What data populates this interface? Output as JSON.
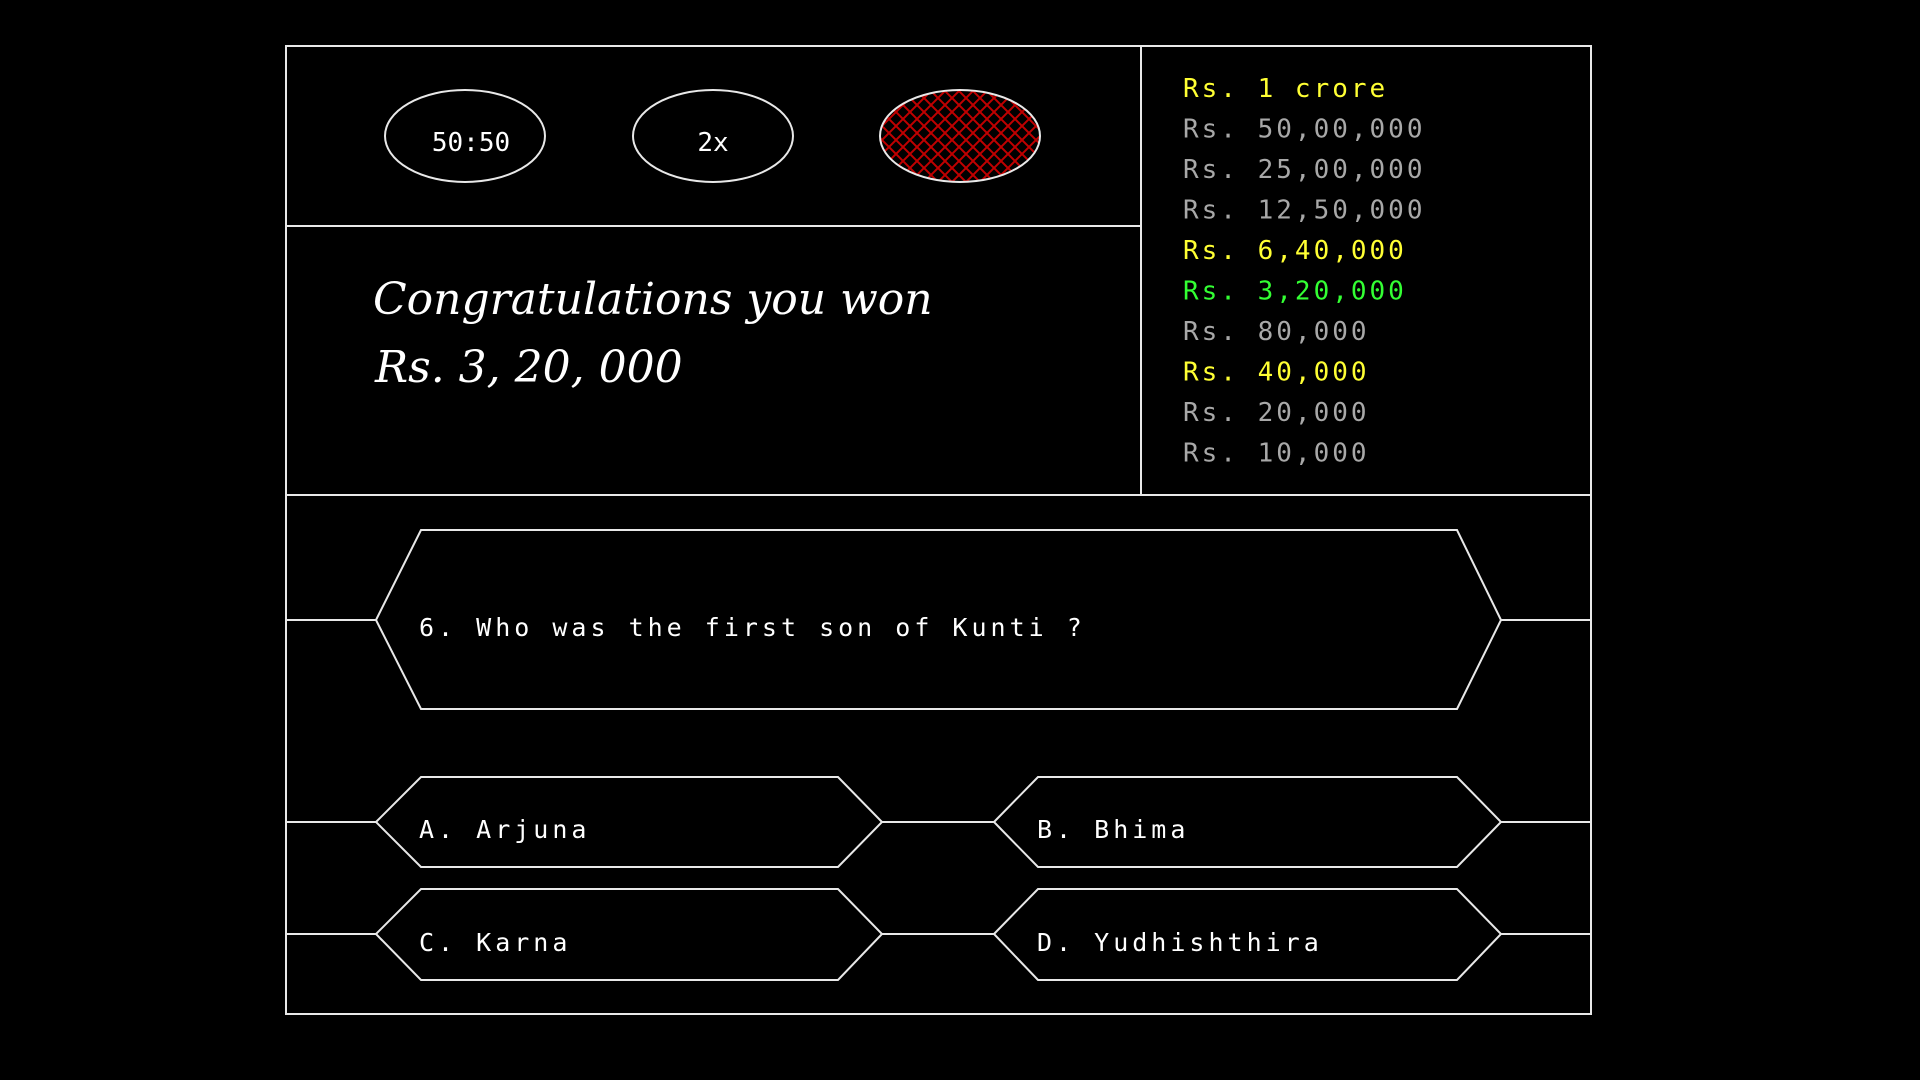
{
  "lifelines": [
    {
      "label": "50:50",
      "used": false
    },
    {
      "label": "2x",
      "used": false
    },
    {
      "label": "",
      "used": true,
      "pattern_color": "#c00000"
    }
  ],
  "message": {
    "line1": "Congratulations you won",
    "line2": "Rs. 3, 20, 000"
  },
  "ladder": [
    {
      "label": "Rs. 1 crore",
      "color": "#ffff33"
    },
    {
      "label": "Rs. 50,00,000",
      "color": "#a8a8a8"
    },
    {
      "label": "Rs. 25,00,000",
      "color": "#a8a8a8"
    },
    {
      "label": "Rs. 12,50,000",
      "color": "#a8a8a8"
    },
    {
      "label": "Rs. 6,40,000",
      "color": "#ffff33"
    },
    {
      "label": "Rs. 3,20,000",
      "color": "#33ff33"
    },
    {
      "label": "Rs. 80,000",
      "color": "#a8a8a8"
    },
    {
      "label": "Rs. 40,000",
      "color": "#ffff33"
    },
    {
      "label": "Rs. 20,000",
      "color": "#a8a8a8"
    },
    {
      "label": "Rs. 10,000",
      "color": "#a8a8a8"
    }
  ],
  "question": "6. Who was the first son of Kunti ?",
  "options": [
    {
      "label": "A. Arjuna"
    },
    {
      "label": "B. Bhima"
    },
    {
      "label": "C. Karna"
    },
    {
      "label": "D. Yudhishthira"
    }
  ]
}
